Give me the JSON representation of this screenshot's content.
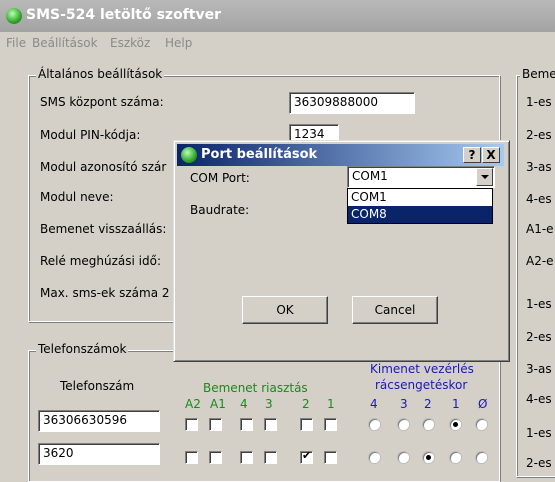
{
  "window": {
    "title": "SMS-524 letöltő szoftver"
  },
  "menu": [
    "File",
    "Beállítások",
    "Eszköz",
    "Help"
  ],
  "general": {
    "group_label": "Általános beállítások",
    "rows": [
      {
        "label": "SMS központ száma:",
        "value": "36309888000"
      },
      {
        "label": "Modul PIN-kódja:",
        "value": "1234"
      },
      {
        "label": "Modul azonosító szár",
        "value": ""
      },
      {
        "label": "Modul neve:",
        "value": ""
      },
      {
        "label": "Bemenet visszaállás:",
        "value": ""
      },
      {
        "label": "Relé meghúzási idő:",
        "value": ""
      },
      {
        "label": "Max. sms-ek száma 2",
        "value": ""
      }
    ]
  },
  "inputs": {
    "group_label": "Beme",
    "rows": [
      "1-es",
      "2-es",
      "3-as",
      "4-es",
      "A1-e",
      "A2-e",
      "1-es",
      "2-es",
      "3-as",
      "4-es",
      "1-es",
      "2-es"
    ]
  },
  "phones": {
    "group_label": "Telefonszámok",
    "col_phone": "Telefonszám",
    "col_alarm": "Bemenet riasztás",
    "col_output_line1": "Kimenet vezérlés",
    "col_output_line2": "rácsengetéskor",
    "alarm_cols": [
      "A2",
      "A1",
      "4",
      "3",
      "2",
      "1"
    ],
    "output_cols": [
      "4",
      "3",
      "2",
      "1",
      "Ø"
    ],
    "rows": [
      {
        "number": "36306630596",
        "alarm": [
          false,
          false,
          false,
          false,
          false,
          false
        ],
        "output_selected": 3
      },
      {
        "number": "3620",
        "alarm": [
          false,
          false,
          false,
          false,
          true,
          false
        ],
        "output_selected": 2
      }
    ]
  },
  "dialog": {
    "title": "Port beállítások",
    "help_button": "?",
    "close_button": "X",
    "com_port_label": "COM Port:",
    "com_port_value": "COM1",
    "baudrate_label": "Baudrate:",
    "options": [
      "COM1",
      "COM8"
    ],
    "highlighted_option": "COM8",
    "ok_label": "OK",
    "cancel_label": "Cancel"
  },
  "colors": {
    "accent": "#0a246a",
    "label_blue": "#1a1ab0",
    "label_green": "#1a8a1a"
  }
}
